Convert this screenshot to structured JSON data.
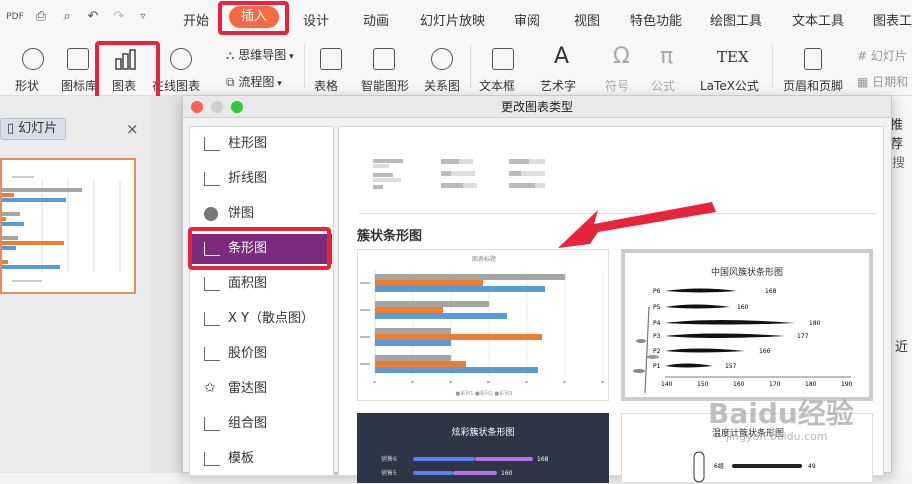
{
  "menubar": {
    "tabs": [
      "开始",
      "插入",
      "设计",
      "动画",
      "幻灯片放映",
      "审阅",
      "视图",
      "特色功能",
      "绘图工具",
      "文本工具",
      "图表工"
    ]
  },
  "ribbon": {
    "shape": "形状",
    "iconlib": "图标库",
    "chart": "图表",
    "online_chart": "在线图表",
    "mindmap": "思维导图",
    "flowchart": "流程图",
    "table": "表格",
    "smart": "智能图形",
    "relation": "关系图",
    "textbox": "文本框",
    "arttext": "艺术字",
    "symbol": "符号",
    "formula": "公式",
    "latex": "LaTeX公式",
    "header_footer": "页眉和页脚",
    "slide_no": "幻灯片",
    "date_time": "日期和",
    "latex_icon": "TEX"
  },
  "left_panel": {
    "tab_label": "幻灯片",
    "close": "×"
  },
  "right_partial": {
    "recommend": "推荐",
    "search": "搜",
    "near": "近"
  },
  "dialog": {
    "title": "更改图表类型",
    "categories": [
      "柱形图",
      "折线图",
      "饼图",
      "条形图",
      "面积图",
      "X Y（散点图）",
      "股价图",
      "雷达图",
      "组合图",
      "模板"
    ],
    "section_title": "簇状条形图",
    "thumb1": {
      "title": "图表标题",
      "legend": "■系列1 ■系列2 ■系列3"
    },
    "thumb2": {
      "title": "中国风簇状条形图",
      "labels": [
        "P6",
        "P5",
        "P4",
        "P3",
        "P2",
        "P1"
      ],
      "values": [
        "168",
        "160",
        "180",
        "177",
        "166",
        "157"
      ],
      "axis": [
        "140",
        "150",
        "160",
        "170",
        "180",
        "190"
      ]
    },
    "thumb3": {
      "title": "炫彩簇状条形图",
      "labels": [
        "销售6",
        "销售5"
      ],
      "values": [
        "168",
        "160"
      ]
    },
    "thumb4": {
      "title": "温度计簇状条形图",
      "labels": [
        "6组"
      ],
      "values": [
        "49"
      ]
    }
  },
  "watermark": {
    "brand": "Baidu经验",
    "url": "jingyan.baidu.com"
  },
  "colors": {
    "accent": "#f36a43",
    "highlight": "#e8233a",
    "selected": "#7b2a7d",
    "series1": "#a5a5a5",
    "series2": "#ed7d31",
    "series3": "#5b9bd5"
  }
}
